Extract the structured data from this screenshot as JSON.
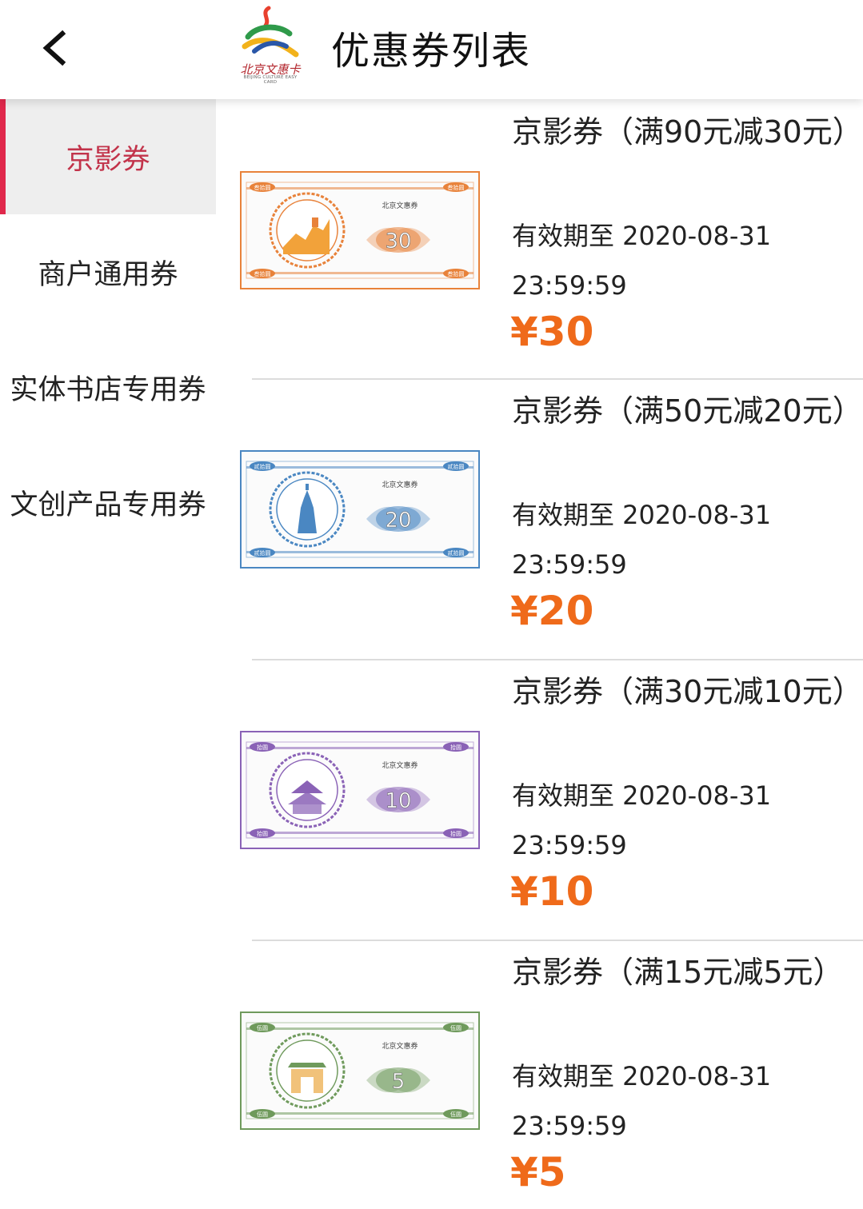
{
  "header": {
    "title": "优惠券列表",
    "logo_text": "北京文惠卡",
    "logo_subtext": "BEIJING CULTURE EASY CARD"
  },
  "sidebar": {
    "items": [
      {
        "label": "京影券",
        "active": true
      },
      {
        "label": "商户通用券",
        "active": false
      },
      {
        "label": "实体书店专用券",
        "active": false
      },
      {
        "label": "文创产品专用券",
        "active": false
      }
    ]
  },
  "ticket_brand": "北京文惠券",
  "coupons": [
    {
      "title": "京影券（满90元减30元）",
      "validity": "有效期至 2020-08-31 23:59:59",
      "price": "¥30",
      "face_value": "30",
      "corner_text": "叁拾圆",
      "theme": "#e8823a",
      "landmark": "great-wall-icon"
    },
    {
      "title": "京影券（满50元减20元）",
      "validity": "有效期至 2020-08-31 23:59:59",
      "price": "¥20",
      "face_value": "20",
      "corner_text": "贰拾圆",
      "theme": "#4a87c2",
      "landmark": "tower-icon"
    },
    {
      "title": "京影券（满30元减10元）",
      "validity": "有效期至 2020-08-31 23:59:59",
      "price": "¥10",
      "face_value": "10",
      "corner_text": "拾圆",
      "theme": "#8a62b6",
      "landmark": "pagoda-icon"
    },
    {
      "title": "京影券（满15元减5元）",
      "validity": "有效期至 2020-08-31 23:59:59",
      "price": "¥5",
      "face_value": "5",
      "corner_text": "伍圆",
      "theme": "#6f9a5c",
      "landmark": "gate-icon"
    }
  ]
}
